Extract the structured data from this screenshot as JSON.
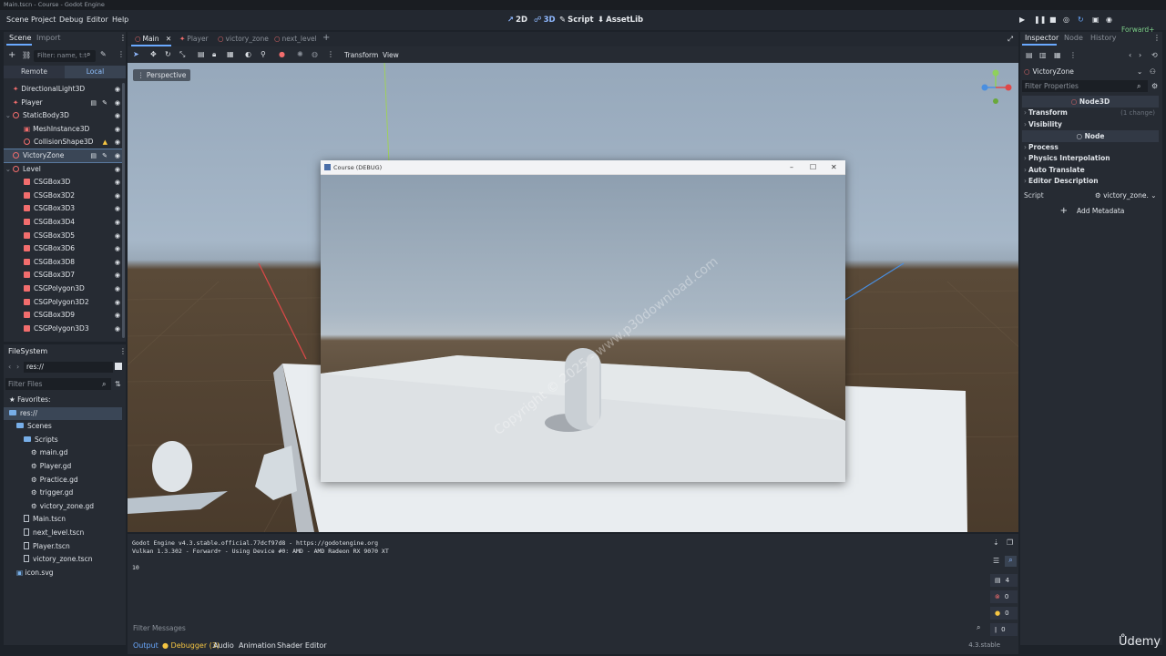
{
  "window": {
    "title": "Main.tscn - Course - Godot Engine"
  },
  "menu": [
    "Scene",
    "Project",
    "Debug",
    "Editor",
    "Help"
  ],
  "workspaces": [
    {
      "label": "2D",
      "icon": "2d-icon"
    },
    {
      "label": "3D",
      "icon": "3d-icon"
    },
    {
      "label": "Script",
      "icon": "script-icon"
    },
    {
      "label": "AssetLib",
      "icon": "assetlib-icon"
    }
  ],
  "renderer": "Forward+",
  "scene_dock": {
    "tabs": [
      "Scene",
      "Import"
    ],
    "filter_placeholder": "Filter: name, t:t",
    "remote_label": "Remote",
    "local_label": "Local",
    "nodes": [
      {
        "name": "DirectionalLight3D",
        "indent": 1,
        "type": "light"
      },
      {
        "name": "Player",
        "indent": 1,
        "type": "light",
        "has_instance": true,
        "has_script": true
      },
      {
        "name": "StaticBody3D",
        "indent": 1,
        "type": "node",
        "expanded": true
      },
      {
        "name": "MeshInstance3D",
        "indent": 2,
        "type": "mesh"
      },
      {
        "name": "CollisionShape3D",
        "indent": 2,
        "type": "node",
        "warning": true
      },
      {
        "name": "VictoryZone",
        "indent": 1,
        "type": "node",
        "selected": true,
        "has_instance": true,
        "has_script": true
      },
      {
        "name": "Level",
        "indent": 1,
        "type": "node",
        "expanded": true
      },
      {
        "name": "CSGBox3D",
        "indent": 2,
        "type": "csg"
      },
      {
        "name": "CSGBox3D2",
        "indent": 2,
        "type": "csg"
      },
      {
        "name": "CSGBox3D3",
        "indent": 2,
        "type": "csg"
      },
      {
        "name": "CSGBox3D4",
        "indent": 2,
        "type": "csg"
      },
      {
        "name": "CSGBox3D5",
        "indent": 2,
        "type": "csg"
      },
      {
        "name": "CSGBox3D6",
        "indent": 2,
        "type": "csg"
      },
      {
        "name": "CSGBox3D8",
        "indent": 2,
        "type": "csg"
      },
      {
        "name": "CSGBox3D7",
        "indent": 2,
        "type": "csg"
      },
      {
        "name": "CSGPolygon3D",
        "indent": 2,
        "type": "csg"
      },
      {
        "name": "CSGPolygon3D2",
        "indent": 2,
        "type": "csg"
      },
      {
        "name": "CSGBox3D9",
        "indent": 2,
        "type": "csg"
      },
      {
        "name": "CSGPolygon3D3",
        "indent": 2,
        "type": "csg"
      }
    ]
  },
  "filesystem": {
    "title": "FileSystem",
    "path": "res://",
    "filter_placeholder": "Filter Files",
    "items": [
      {
        "name": "Favorites:",
        "indent": 0,
        "kind": "favorites"
      },
      {
        "name": "res://",
        "indent": 0,
        "kind": "folder",
        "selected": true
      },
      {
        "name": "Scenes",
        "indent": 1,
        "kind": "folder"
      },
      {
        "name": "Scripts",
        "indent": 2,
        "kind": "folder"
      },
      {
        "name": "main.gd",
        "indent": 3,
        "kind": "script"
      },
      {
        "name": "Player.gd",
        "indent": 3,
        "kind": "script"
      },
      {
        "name": "Practice.gd",
        "indent": 3,
        "kind": "script"
      },
      {
        "name": "trigger.gd",
        "indent": 3,
        "kind": "script"
      },
      {
        "name": "victory_zone.gd",
        "indent": 3,
        "kind": "script"
      },
      {
        "name": "Main.tscn",
        "indent": 2,
        "kind": "scene"
      },
      {
        "name": "next_level.tscn",
        "indent": 2,
        "kind": "scene"
      },
      {
        "name": "Player.tscn",
        "indent": 2,
        "kind": "scene"
      },
      {
        "name": "victory_zone.tscn",
        "indent": 2,
        "kind": "scene"
      },
      {
        "name": "icon.svg",
        "indent": 1,
        "kind": "image"
      }
    ]
  },
  "editor_tabs": [
    {
      "label": "Main",
      "active": true
    },
    {
      "label": "Player"
    },
    {
      "label": "victory_zone"
    },
    {
      "label": "next_level"
    }
  ],
  "viewport": {
    "transform_label": "Transform",
    "view_label": "View",
    "perspective_label": "Perspective"
  },
  "debug_window": {
    "title": "Course (DEBUG)",
    "watermark": "Copyright © 2025 - www.p30download.com"
  },
  "output": {
    "lines": [
      "Godot Engine v4.3.stable.official.77dcf97d8 - https://godotengine.org",
      "Vulkan 1.3.302 - Forward+ - Using Device #0: AMD - AMD Radeon RX 9070 XT",
      "",
      "10"
    ],
    "filter_placeholder": "Filter Messages",
    "counters": [
      "4",
      "0",
      "0",
      "0"
    ],
    "tabs": [
      "Output",
      "Debugger (3)",
      "Audio",
      "Animation",
      "Shader Editor"
    ],
    "version": "4.3.stable"
  },
  "inspector": {
    "tabs": [
      "Inspector",
      "Node",
      "History"
    ],
    "object": "VictoryZone",
    "filter_placeholder": "Filter Properties",
    "section_node3d": "Node3D",
    "node3d_props": [
      {
        "label": "Transform",
        "changes": "(1 change)"
      },
      {
        "label": "Visibility"
      }
    ],
    "section_node": "Node",
    "node_props": [
      {
        "label": "Process"
      },
      {
        "label": "Physics Interpolation"
      },
      {
        "label": "Auto Translate"
      },
      {
        "label": "Editor Description"
      }
    ],
    "script_label": "Script",
    "script_value": "victory_zone.",
    "add_metadata": "Add Metadata"
  },
  "branding": "Ůdemy"
}
